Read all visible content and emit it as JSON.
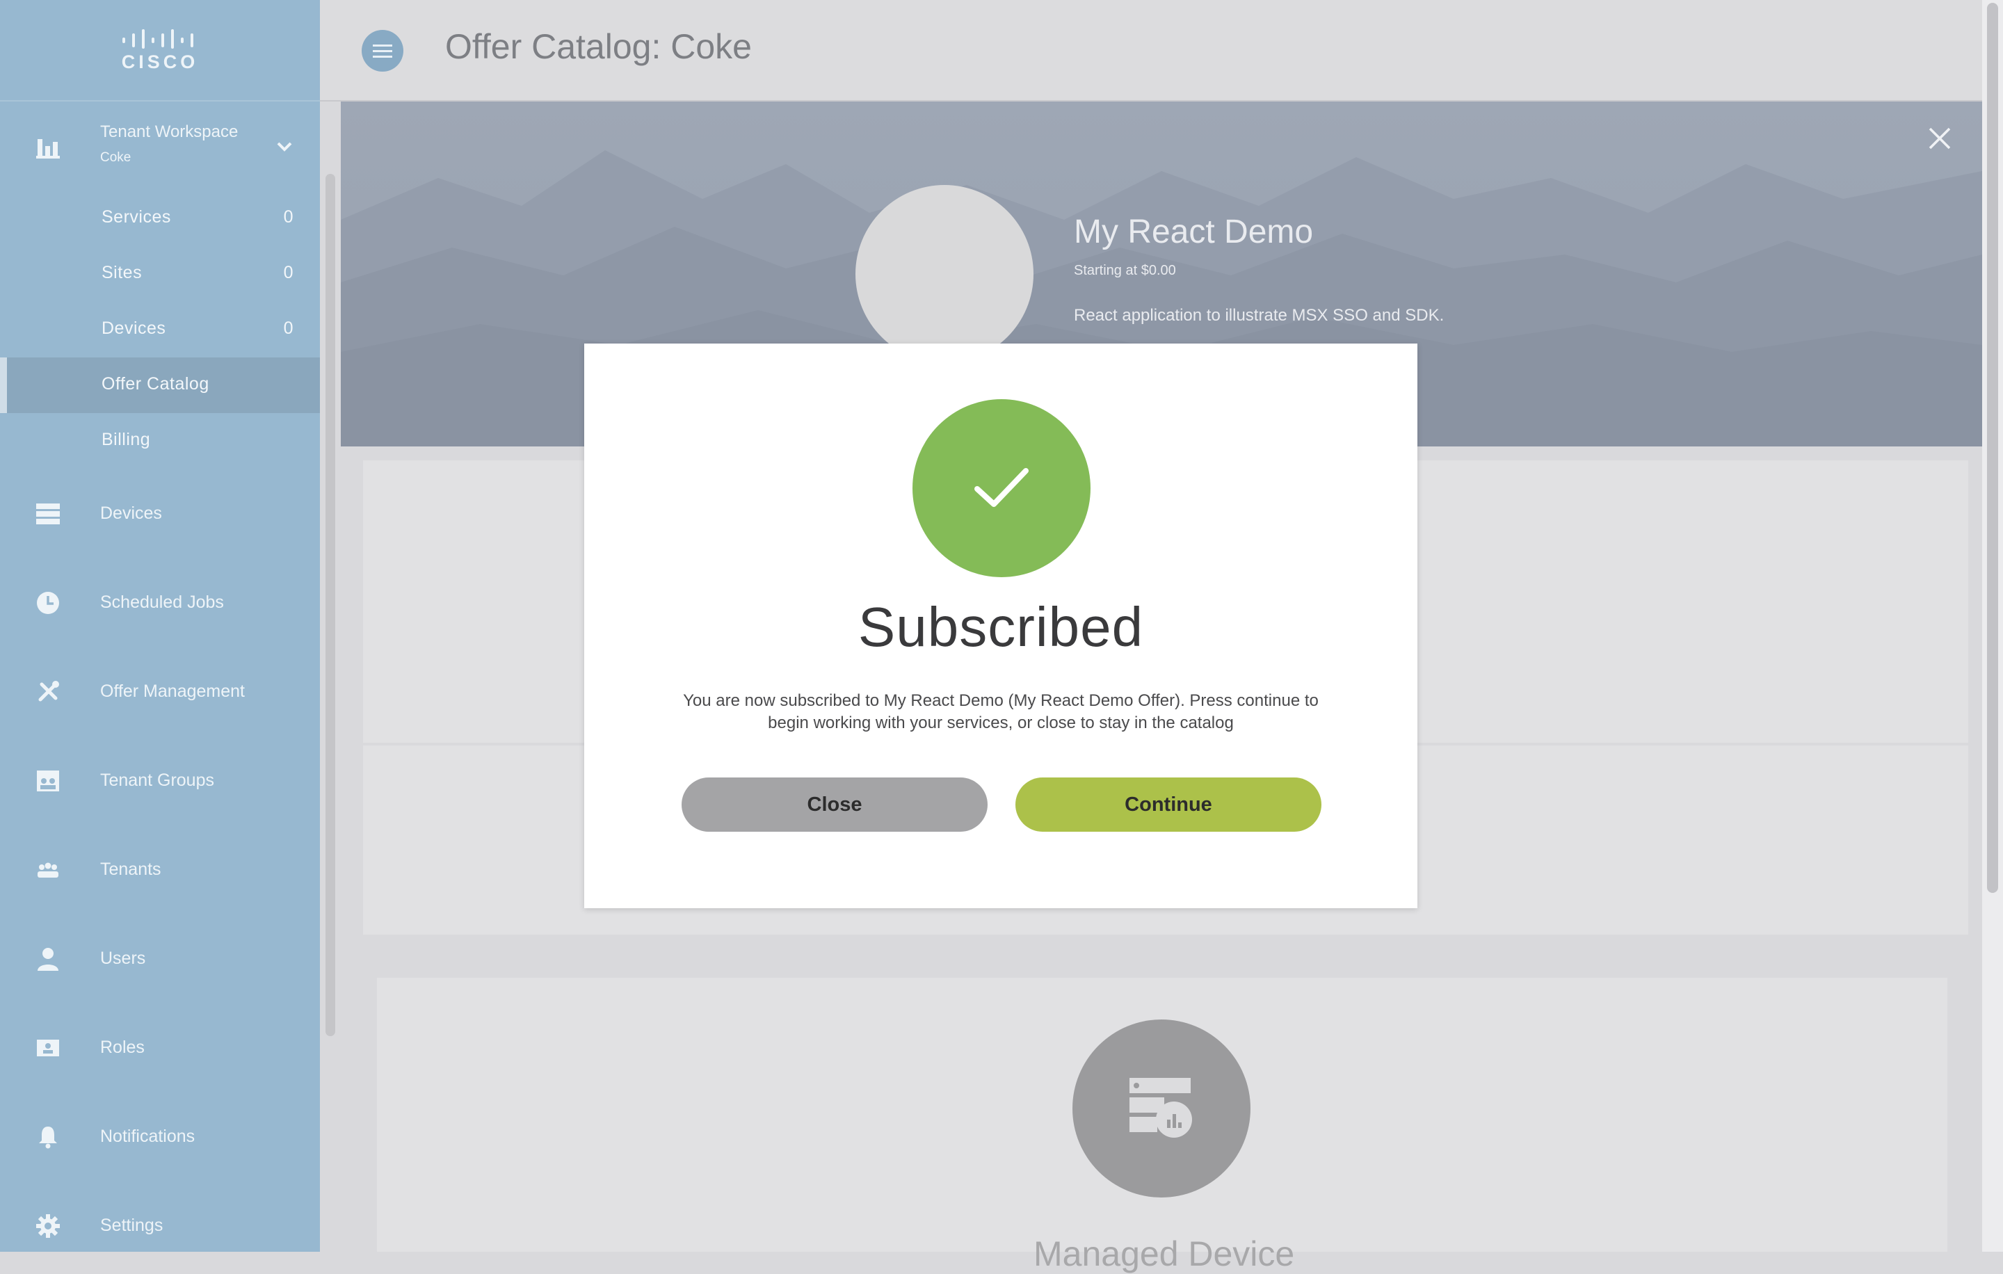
{
  "brand": {
    "logo_text": "CISCO"
  },
  "sidebar": {
    "workspace": {
      "title": "Tenant Workspace",
      "subtitle": "Coke"
    },
    "sub_items": [
      {
        "label": "Services",
        "count": "0"
      },
      {
        "label": "Sites",
        "count": "0"
      },
      {
        "label": "Devices",
        "count": "0"
      },
      {
        "label": "Offer Catalog",
        "active": true
      },
      {
        "label": "Billing"
      }
    ],
    "nav_items": [
      {
        "label": "Devices",
        "icon": "devices-icon"
      },
      {
        "label": "Scheduled Jobs",
        "icon": "clock-icon"
      },
      {
        "label": "Offer Management",
        "icon": "tools-icon"
      },
      {
        "label": "Tenant Groups",
        "icon": "tenant-groups-icon"
      },
      {
        "label": "Tenants",
        "icon": "tenants-icon"
      },
      {
        "label": "Users",
        "icon": "user-icon"
      },
      {
        "label": "Roles",
        "icon": "roles-icon"
      },
      {
        "label": "Notifications",
        "icon": "bell-icon"
      },
      {
        "label": "Settings",
        "icon": "gear-icon"
      }
    ]
  },
  "header": {
    "title": "Offer Catalog: Coke"
  },
  "offer": {
    "title": "My React Demo",
    "price": "Starting at $0.00",
    "description": "React application to illustrate MSX SSO and SDK."
  },
  "background": {
    "device_card_title": "Managed Device"
  },
  "modal": {
    "title": "Subscribed",
    "message": "You are now subscribed to My React Demo (My React Demo Offer). Press continue to begin working with your services, or close to stay in the catalog",
    "close_label": "Close",
    "continue_label": "Continue"
  },
  "colors": {
    "sidebar": "#97b8d0",
    "success": "#84bb57",
    "continue_button": "#acc14a",
    "close_button": "#a4a4a6"
  }
}
